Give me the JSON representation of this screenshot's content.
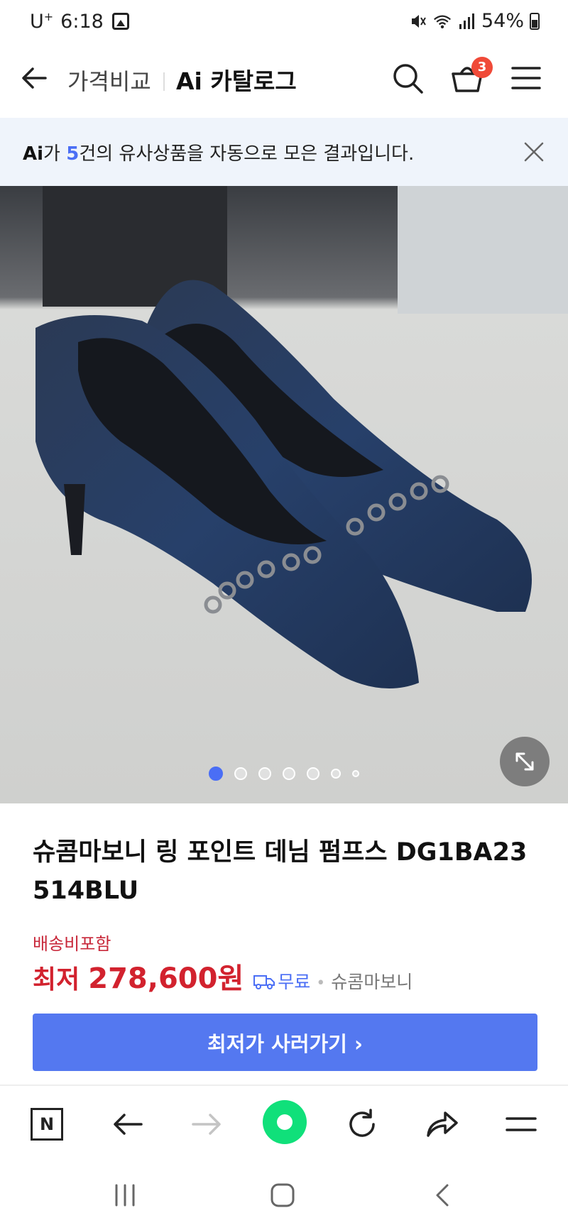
{
  "status_bar": {
    "carrier": "U",
    "carrier_sup": "+",
    "time": "6:18",
    "battery": "54%"
  },
  "header": {
    "title_primary": "가격비교",
    "title_secondary": "Ai 카탈로그",
    "cart_count": "3",
    "icons": [
      "back-arrow-icon",
      "search-icon",
      "cart-icon",
      "menu-icon"
    ]
  },
  "ai_banner": {
    "logo": "Ai",
    "text_before": "가 ",
    "count": "5",
    "text_after": "건의 유사상품을 자동으로 모은 결과입니다."
  },
  "gallery": {
    "total_images": 7,
    "active_index": 0
  },
  "product": {
    "title": "슈콤마보니 링 포인트 데님 펌프스 DG1BA23 514BLU",
    "shipping_note": "배송비포함",
    "price_label": "최저",
    "price": "278,600원",
    "shipping_fee": "무료",
    "seller": "슈콤마보니",
    "cta_label": "최저가 사러가기 ›"
  },
  "browser_bar": {
    "home_label": "N"
  },
  "colors": {
    "accent_blue": "#5478f0",
    "price_red": "#d2222e",
    "banner_bg": "#eff4fb",
    "badge_red": "#f04a38",
    "naver_green": "#10e07a"
  }
}
